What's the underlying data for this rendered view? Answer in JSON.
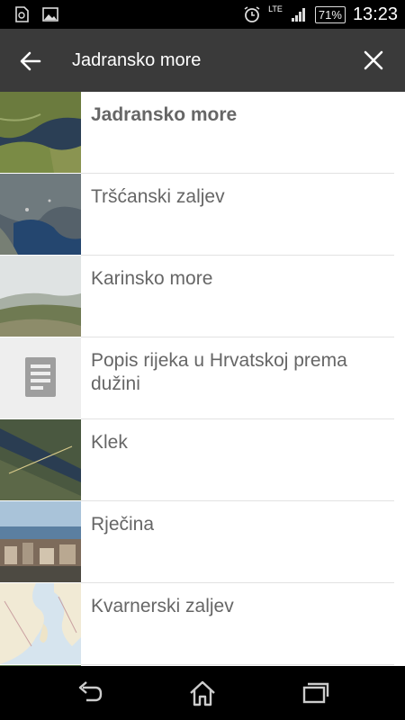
{
  "status": {
    "time": "13:23",
    "battery": "71%",
    "network": "LTE",
    "icons": [
      "sd-card-icon",
      "image-icon",
      "alarm-icon",
      "signal-icon"
    ]
  },
  "appbar": {
    "title": "Jadransko more",
    "back_icon": "arrow-left-icon",
    "close_icon": "close-icon"
  },
  "results": [
    {
      "label": "Jadransko more",
      "bold": true,
      "thumb": "satellite-adriatic"
    },
    {
      "label": "Tršćanski zaljev",
      "bold": false,
      "thumb": "satellite-trieste"
    },
    {
      "label": "Karinsko more",
      "bold": false,
      "thumb": "landscape-hills"
    },
    {
      "label": "Popis rijeka u Hrvatskoj prema dužini",
      "bold": false,
      "thumb": "document-icon"
    },
    {
      "label": "Klek",
      "bold": false,
      "thumb": "satellite-coast"
    },
    {
      "label": "Rječina",
      "bold": false,
      "thumb": "city-photo"
    },
    {
      "label": "Kvarnerski zaljev",
      "bold": false,
      "thumb": "map-kvarner"
    }
  ],
  "navbar": {
    "back": "back-icon",
    "home": "home-icon",
    "recents": "recents-icon"
  }
}
